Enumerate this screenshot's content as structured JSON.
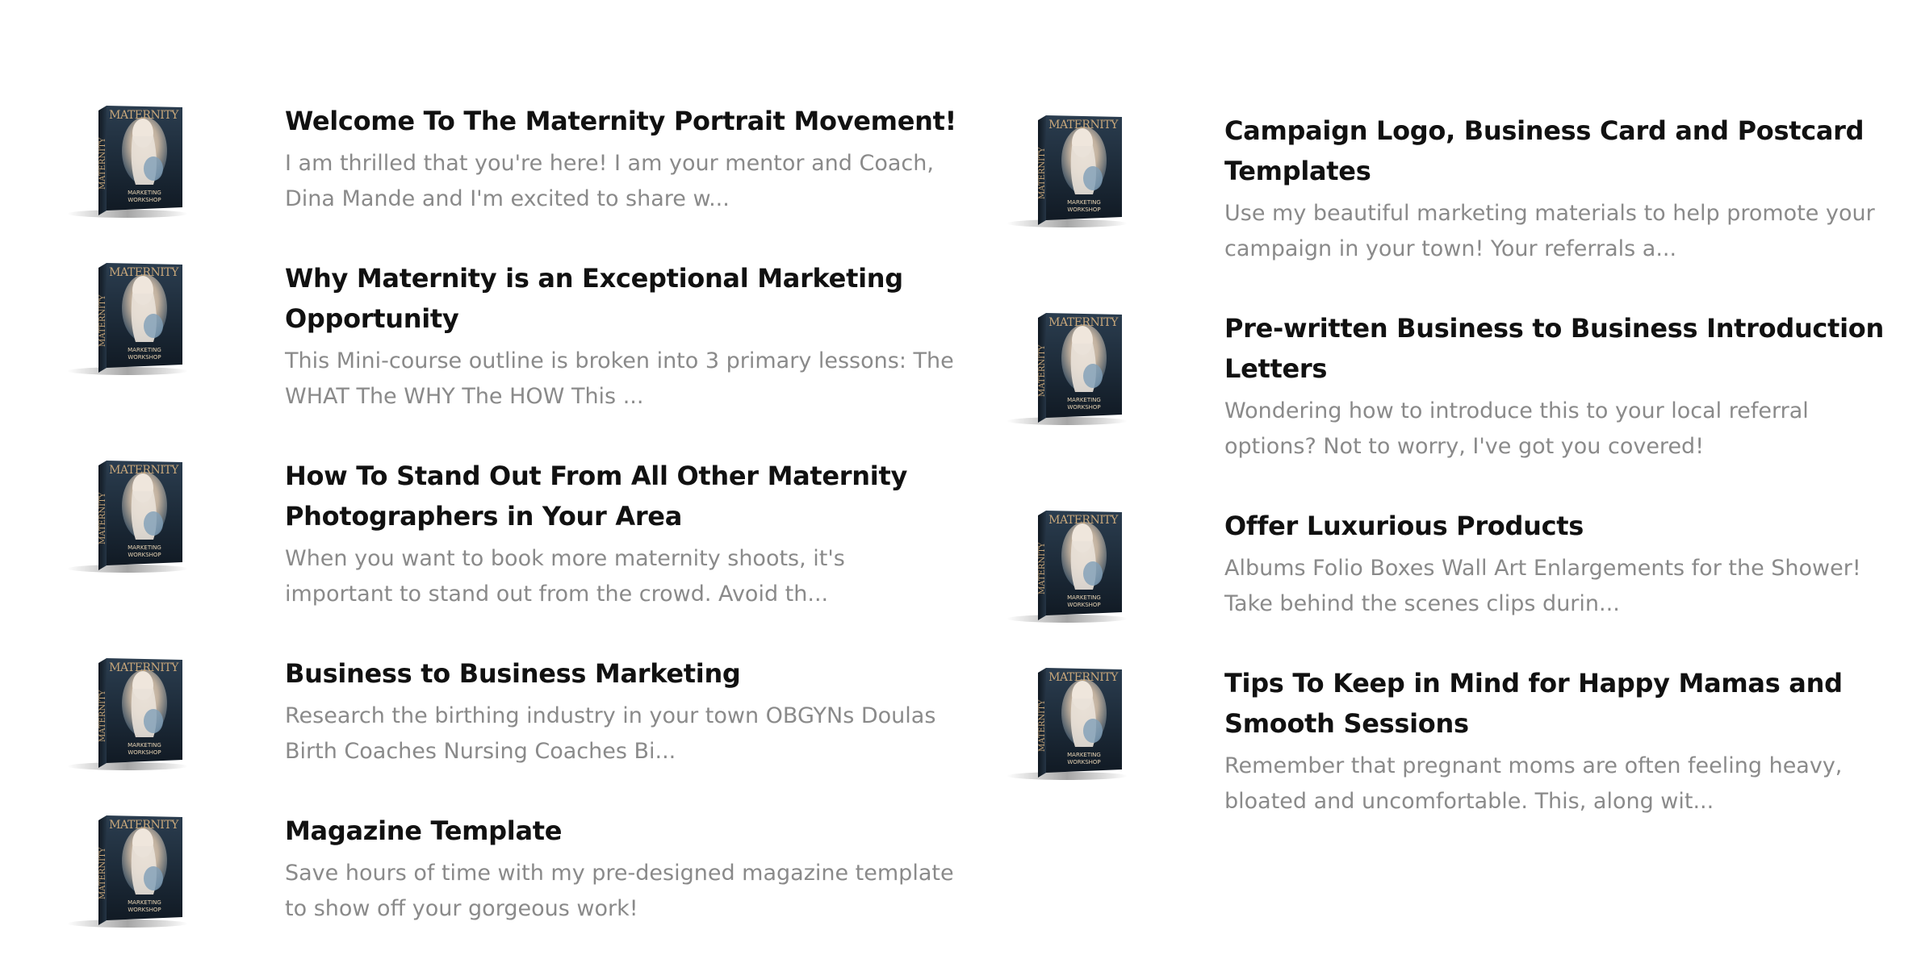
{
  "colors": {
    "title": "#111111",
    "description": "#8a8a8a",
    "box_dark": "#1c2a38",
    "box_accent": "#c8a77a"
  },
  "thumbnail": {
    "icon": "maternity-marketing-workshop-product-box",
    "text": "MATERNITY MARKETING WORKSHOP"
  },
  "left_column": [
    {
      "title": "Welcome To The Maternity Portrait Movement!",
      "description": "I am thrilled that you're here! I am your mentor and Coach, Dina Mande and I'm excited to share w..."
    },
    {
      "title": "Why Maternity is an Exceptional Marketing Opportunity",
      "description": "This Mini-course outline is broken into 3 primary lessons: The WHAT The WHY The HOW This ..."
    },
    {
      "title": "How To Stand Out From All Other Maternity Photographers in Your Area",
      "description": "When you want to book more maternity shoots, it's important to stand out from the crowd. Avoid th..."
    },
    {
      "title": "Business to Business Marketing",
      "description": "Research the birthing industry in your town OBGYNs Doulas Birth Coaches Nursing Coaches Bi..."
    },
    {
      "title": "Magazine Template",
      "description": "Save hours of time with my pre-designed magazine template to show off your gorgeous work!"
    }
  ],
  "right_column": [
    {
      "title": "Campaign Logo, Business Card and Postcard Templates",
      "description": "Use my beautiful marketing materials to help promote your campaign in your town! Your referrals a..."
    },
    {
      "title": "Pre-written Business to Business Introduction Letters",
      "description": "Wondering how to introduce this to your local referral options? Not to worry, I've got you covered!"
    },
    {
      "title": "Offer Luxurious Products",
      "description": "Albums Folio Boxes Wall Art Enlargements for the Shower! Take behind the scenes clips durin..."
    },
    {
      "title": "Tips To Keep in Mind for Happy Mamas and Smooth Sessions",
      "description": "Remember that pregnant moms are often feeling heavy, bloated and uncomfortable. This, along wit..."
    }
  ]
}
